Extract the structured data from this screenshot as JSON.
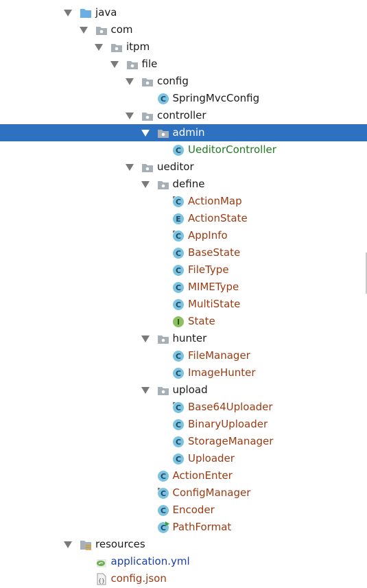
{
  "tree": {
    "nodes": [
      {
        "name": "tree-node-java",
        "label": "java",
        "icon": "source-folder-icon",
        "level": 0,
        "expanded": true,
        "color": "plain"
      },
      {
        "name": "tree-node-com",
        "label": "com",
        "icon": "package-icon",
        "level": 1,
        "expanded": true,
        "color": "plain"
      },
      {
        "name": "tree-node-itpm",
        "label": "itpm",
        "icon": "package-icon",
        "level": 2,
        "expanded": true,
        "color": "plain"
      },
      {
        "name": "tree-node-file",
        "label": "file",
        "icon": "package-icon",
        "level": 3,
        "expanded": true,
        "color": "plain"
      },
      {
        "name": "tree-node-config",
        "label": "config",
        "icon": "package-icon",
        "level": 4,
        "expanded": true,
        "color": "plain"
      },
      {
        "name": "tree-node-springmvcconfig",
        "label": "SpringMvcConfig",
        "icon": "class-icon",
        "level": 5,
        "expanded": null,
        "color": "plain"
      },
      {
        "name": "tree-node-controller",
        "label": "controller",
        "icon": "package-icon",
        "level": 4,
        "expanded": true,
        "color": "plain"
      },
      {
        "name": "tree-node-admin",
        "label": "admin",
        "icon": "package-icon",
        "level": 5,
        "expanded": true,
        "color": "plain",
        "selected": true
      },
      {
        "name": "tree-node-ueditorcontroller",
        "label": "UeditorController",
        "icon": "class-icon",
        "level": 6,
        "expanded": null,
        "color": "green"
      },
      {
        "name": "tree-node-ueditor",
        "label": "ueditor",
        "icon": "package-icon",
        "level": 4,
        "expanded": true,
        "color": "plain"
      },
      {
        "name": "tree-node-define",
        "label": "define",
        "icon": "package-icon",
        "level": 5,
        "expanded": true,
        "color": "plain"
      },
      {
        "name": "tree-node-actionmap",
        "label": "ActionMap",
        "icon": "abstract-class-icon",
        "level": 6,
        "expanded": null,
        "color": "red"
      },
      {
        "name": "tree-node-actionstate",
        "label": "ActionState",
        "icon": "enum-icon",
        "level": 6,
        "expanded": null,
        "color": "red"
      },
      {
        "name": "tree-node-appinfo",
        "label": "AppInfo",
        "icon": "abstract-class-icon",
        "level": 6,
        "expanded": null,
        "color": "red"
      },
      {
        "name": "tree-node-basestate",
        "label": "BaseState",
        "icon": "class-icon",
        "level": 6,
        "expanded": null,
        "color": "red"
      },
      {
        "name": "tree-node-filetype",
        "label": "FileType",
        "icon": "class-icon",
        "level": 6,
        "expanded": null,
        "color": "red"
      },
      {
        "name": "tree-node-mimetype",
        "label": "MIMEType",
        "icon": "class-icon",
        "level": 6,
        "expanded": null,
        "color": "red"
      },
      {
        "name": "tree-node-multistate",
        "label": "MultiState",
        "icon": "class-icon",
        "level": 6,
        "expanded": null,
        "color": "red"
      },
      {
        "name": "tree-node-state",
        "label": "State",
        "icon": "interface-icon",
        "level": 6,
        "expanded": null,
        "color": "red"
      },
      {
        "name": "tree-node-hunter",
        "label": "hunter",
        "icon": "package-icon",
        "level": 5,
        "expanded": true,
        "color": "plain"
      },
      {
        "name": "tree-node-filemanager",
        "label": "FileManager",
        "icon": "class-icon",
        "level": 6,
        "expanded": null,
        "color": "red"
      },
      {
        "name": "tree-node-imagehunter",
        "label": "ImageHunter",
        "icon": "class-icon",
        "level": 6,
        "expanded": null,
        "color": "red"
      },
      {
        "name": "tree-node-upload",
        "label": "upload",
        "icon": "package-icon",
        "level": 5,
        "expanded": true,
        "color": "plain"
      },
      {
        "name": "tree-node-base64uploader",
        "label": "Base64Uploader",
        "icon": "abstract-class-icon",
        "level": 6,
        "expanded": null,
        "color": "red"
      },
      {
        "name": "tree-node-binaryuploader",
        "label": "BinaryUploader",
        "icon": "class-icon",
        "level": 6,
        "expanded": null,
        "color": "red"
      },
      {
        "name": "tree-node-storagemanager",
        "label": "StorageManager",
        "icon": "class-icon",
        "level": 6,
        "expanded": null,
        "color": "red"
      },
      {
        "name": "tree-node-uploader",
        "label": "Uploader",
        "icon": "class-icon",
        "level": 6,
        "expanded": null,
        "color": "red"
      },
      {
        "name": "tree-node-actionenter",
        "label": "ActionEnter",
        "icon": "class-icon",
        "level": 5,
        "expanded": null,
        "color": "red"
      },
      {
        "name": "tree-node-configmanager",
        "label": "ConfigManager",
        "icon": "abstract-class-icon",
        "level": 5,
        "expanded": null,
        "color": "red"
      },
      {
        "name": "tree-node-encoder",
        "label": "Encoder",
        "icon": "class-icon",
        "level": 5,
        "expanded": null,
        "color": "red"
      },
      {
        "name": "tree-node-pathformat",
        "label": "PathFormat",
        "icon": "runnable-class-icon",
        "level": 5,
        "expanded": null,
        "color": "red"
      },
      {
        "name": "tree-node-resources",
        "label": "resources",
        "icon": "resources-folder-icon",
        "level": 0,
        "expanded": true,
        "color": "plain"
      },
      {
        "name": "tree-node-application-yml",
        "label": "application.yml",
        "icon": "spring-yaml-icon",
        "level": 1,
        "expanded": null,
        "color": "blue"
      },
      {
        "name": "tree-node-config-json",
        "label": "config.json",
        "icon": "json-file-icon",
        "level": 1,
        "expanded": null,
        "color": "red"
      }
    ]
  },
  "colors": {
    "selection": "#2f71c1",
    "class_icon": "#7cc3e0",
    "interface_icon": "#8cc063",
    "folder_icon": "#a7b0b7",
    "source_folder_icon": "#6aaee3"
  }
}
